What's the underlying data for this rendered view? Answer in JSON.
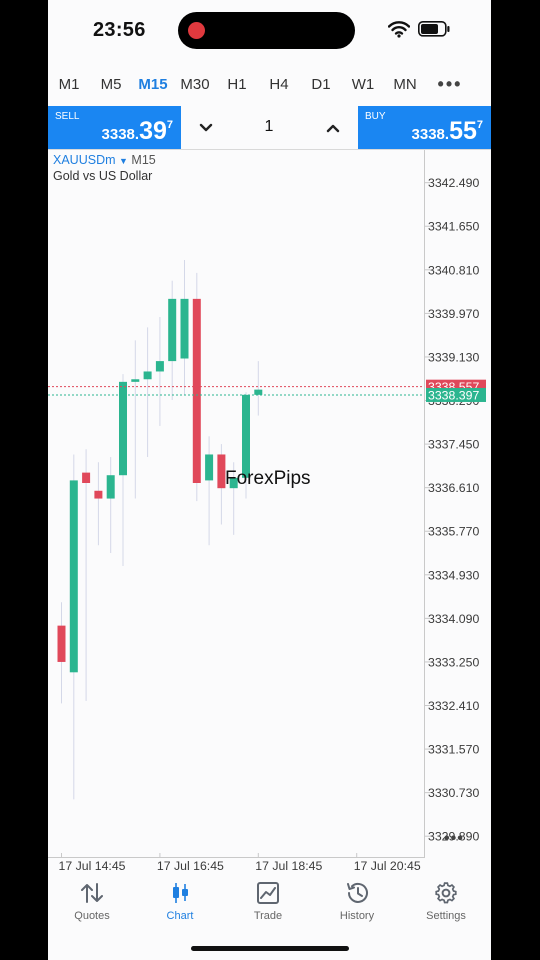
{
  "status": {
    "time": "23:56"
  },
  "timeframes": {
    "items": [
      "M1",
      "M5",
      "M15",
      "M30",
      "H1",
      "H4",
      "D1",
      "W1",
      "MN"
    ],
    "active": "M15",
    "more_icon": "more-dots-icon"
  },
  "trade": {
    "sell": {
      "label": "SELL",
      "price_small": "3338.",
      "price_big": "39",
      "price_sup": "7"
    },
    "buy": {
      "label": "BUY",
      "price_small": "3338.",
      "price_big": "55",
      "price_sup": "7"
    },
    "lot": "1"
  },
  "chart": {
    "symbol": "XAUUSDm",
    "timeframe": "M15",
    "description": "Gold vs US Dollar",
    "watermark": "ForexPips"
  },
  "tabs": [
    {
      "label": "Quotes",
      "icon": "quotes-arrows-icon",
      "active": false
    },
    {
      "label": "Chart",
      "icon": "candlestick-icon",
      "active": true
    },
    {
      "label": "Trade",
      "icon": "trade-chart-icon",
      "active": false
    },
    {
      "label": "History",
      "icon": "history-clock-icon",
      "active": false
    },
    {
      "label": "Settings",
      "icon": "gear-icon",
      "active": false
    }
  ],
  "colors": {
    "bull": "#2bb58f",
    "bear": "#e0485a",
    "accent": "#1f7fe0",
    "trade_button": "#1a86f2"
  },
  "chart_data": {
    "type": "candlestick",
    "symbol": "XAUUSDm",
    "timeframe": "M15",
    "ylim": [
      3329.47,
      3343.12
    ],
    "price_ticks": [
      3342.49,
      3341.65,
      3340.81,
      3339.97,
      3339.13,
      3338.29,
      3337.45,
      3336.61,
      3335.77,
      3334.93,
      3334.09,
      3333.25,
      3332.41,
      3331.57,
      3330.73,
      3329.89
    ],
    "time_ticks": [
      {
        "label": "17 Jul 14:45",
        "candle_index": 0
      },
      {
        "label": "17 Jul 16:45",
        "candle_index": 8
      },
      {
        "label": "17 Jul 18:45",
        "candle_index": 16
      },
      {
        "label": "17 Jul 20:45",
        "candle_index": 24
      }
    ],
    "ask_line": {
      "value": 3338.557,
      "label": "3338.557"
    },
    "bid_line": {
      "value": 3338.397,
      "label": "3338.397"
    },
    "candles": [
      {
        "o": 3333.95,
        "h": 3334.4,
        "l": 3332.45,
        "c": 3333.25
      },
      {
        "o": 3333.05,
        "h": 3337.25,
        "l": 3330.6,
        "c": 3336.75
      },
      {
        "o": 3336.9,
        "h": 3337.35,
        "l": 3332.5,
        "c": 3336.7
      },
      {
        "o": 3336.55,
        "h": 3337.1,
        "l": 3335.5,
        "c": 3336.4
      },
      {
        "o": 3336.4,
        "h": 3337.2,
        "l": 3335.35,
        "c": 3336.85
      },
      {
        "o": 3336.85,
        "h": 3338.8,
        "l": 3335.1,
        "c": 3338.65
      },
      {
        "o": 3338.65,
        "h": 3339.45,
        "l": 3336.4,
        "c": 3338.7
      },
      {
        "o": 3338.7,
        "h": 3339.7,
        "l": 3337.2,
        "c": 3338.85
      },
      {
        "o": 3338.85,
        "h": 3339.9,
        "l": 3337.8,
        "c": 3339.05
      },
      {
        "o": 3339.05,
        "h": 3340.6,
        "l": 3338.3,
        "c": 3340.25
      },
      {
        "o": 3339.1,
        "h": 3341.0,
        "l": 3338.4,
        "c": 3340.25
      },
      {
        "o": 3340.25,
        "h": 3340.75,
        "l": 3336.35,
        "c": 3336.7
      },
      {
        "o": 3336.75,
        "h": 3337.6,
        "l": 3335.5,
        "c": 3337.25
      },
      {
        "o": 3337.25,
        "h": 3337.45,
        "l": 3335.9,
        "c": 3336.6
      },
      {
        "o": 3336.6,
        "h": 3337.1,
        "l": 3335.7,
        "c": 3336.8
      },
      {
        "o": 3336.8,
        "h": 3338.45,
        "l": 3336.4,
        "c": 3338.4
      },
      {
        "o": 3338.4,
        "h": 3339.05,
        "l": 3338.0,
        "c": 3338.5
      }
    ]
  }
}
